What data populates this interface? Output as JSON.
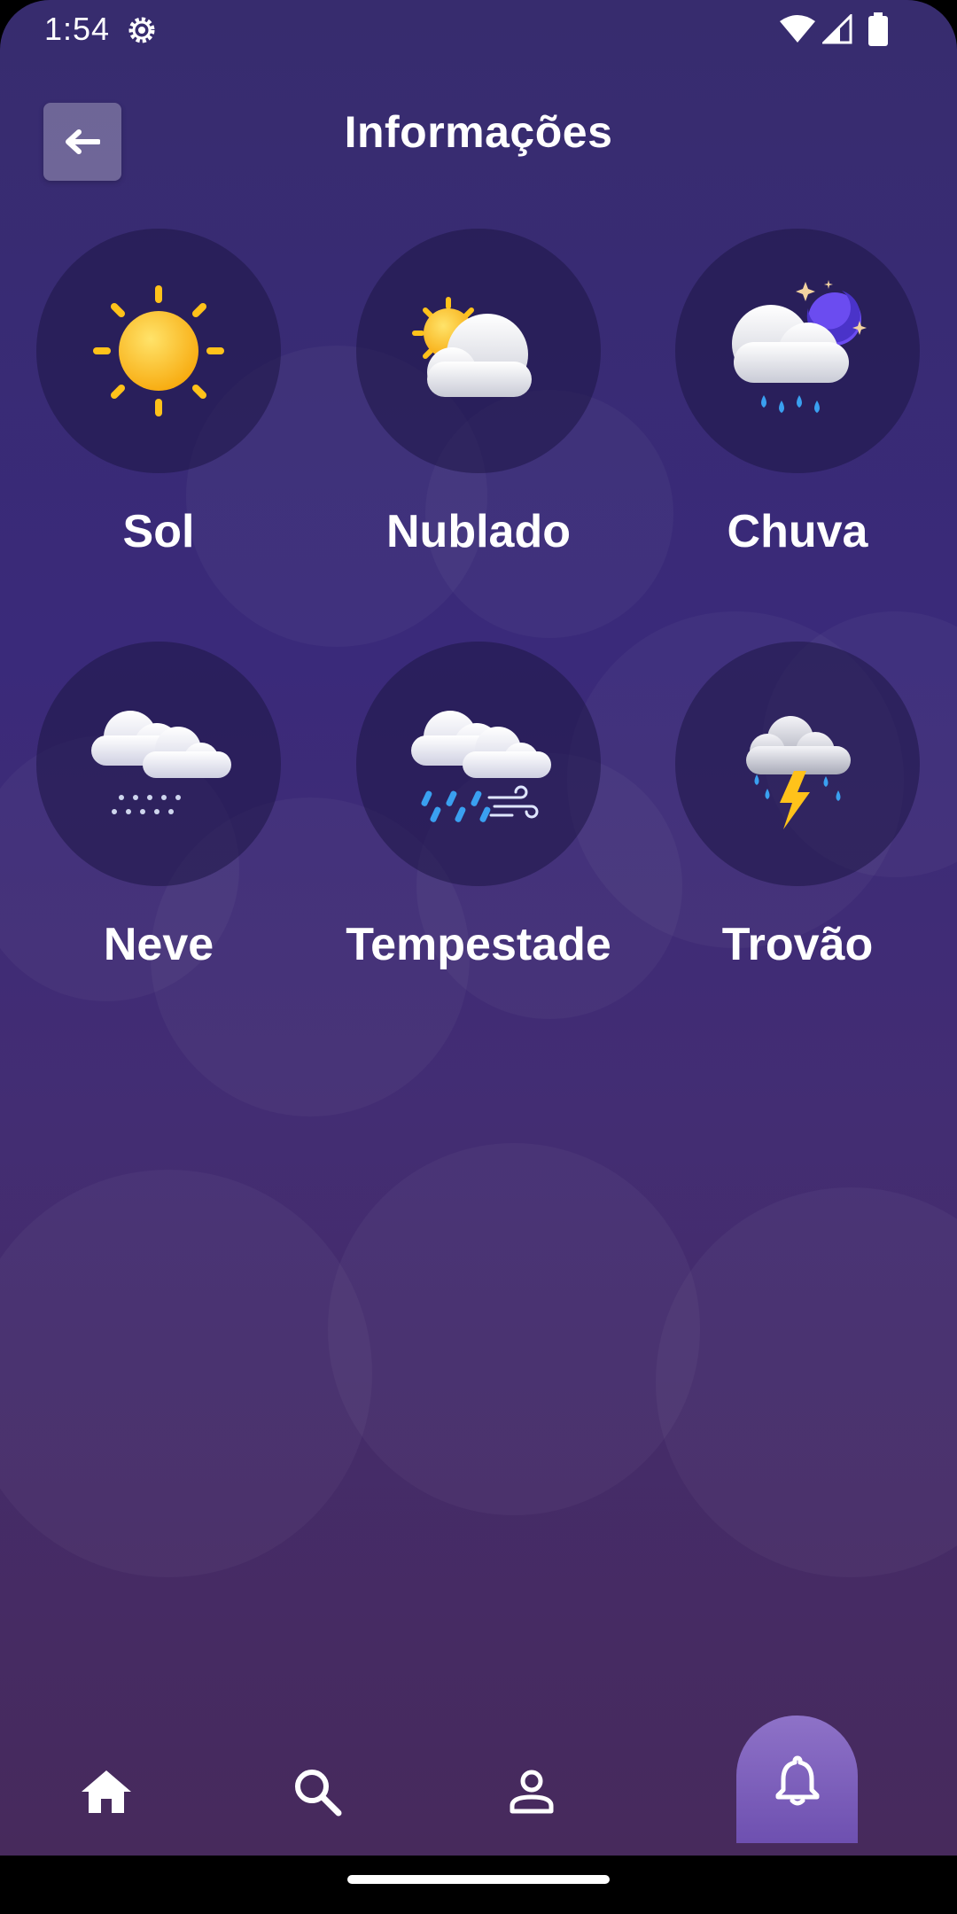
{
  "status_bar": {
    "time": "1:54",
    "icons": [
      "settings-gear-icon",
      "wifi-icon",
      "cell-signal-icon",
      "battery-icon"
    ]
  },
  "header": {
    "title": "Informações",
    "back_icon": "arrow-left-icon"
  },
  "weather_tiles": [
    {
      "label": "Sol",
      "icon": "sun-icon"
    },
    {
      "label": "Nublado",
      "icon": "partly-cloudy-icon"
    },
    {
      "label": "Chuva",
      "icon": "rain-night-icon"
    },
    {
      "label": "Neve",
      "icon": "snow-icon"
    },
    {
      "label": "Tempestade",
      "icon": "storm-wind-icon"
    },
    {
      "label": "Trovão",
      "icon": "thunder-icon"
    }
  ],
  "bottom_nav": {
    "items": [
      {
        "icon": "home-icon"
      },
      {
        "icon": "search-icon"
      },
      {
        "icon": "profile-icon"
      },
      {
        "icon": "bell-icon",
        "active": true
      }
    ]
  },
  "colors": {
    "background_top": "#372c6e",
    "background_bottom": "#472a5c",
    "active_tab": "#8e72c8",
    "sun": "#ffc21a",
    "moon": "#6b4cf0",
    "rain": "#3aa0f0",
    "lightning": "#ffc21a"
  }
}
